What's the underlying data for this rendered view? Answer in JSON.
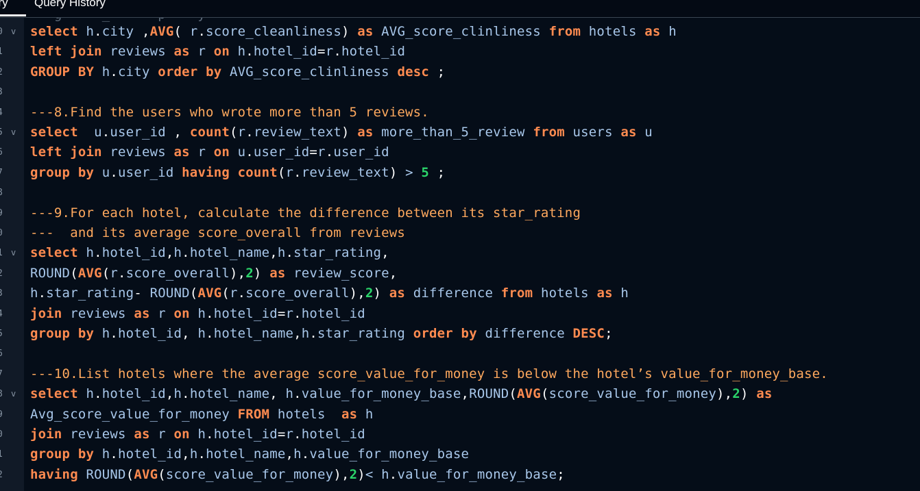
{
  "tabs": [
    {
      "label": "ery"
    },
    {
      "label": "Query History"
    }
  ],
  "partial_top_line": "-- g     _      p    y",
  "line_numbers": [
    "0",
    "1",
    "2",
    "3",
    "4",
    "5",
    "6",
    "7",
    "8",
    "9",
    "0",
    "1",
    "2",
    "3",
    "4",
    "5",
    "6",
    "7",
    "8",
    "9",
    "0",
    "1",
    "2"
  ],
  "fold_rows": [
    0,
    5,
    11,
    18
  ],
  "fold_glyph": "v",
  "code_lines": [
    [
      [
        "kw",
        "select"
      ],
      [
        "id",
        " h"
      ],
      [
        "p",
        "."
      ],
      [
        "id",
        "city "
      ],
      [
        "p",
        ","
      ],
      [
        "kw",
        "AVG"
      ],
      [
        "p",
        "("
      ],
      [
        "id",
        " r"
      ],
      [
        "p",
        "."
      ],
      [
        "id",
        "score_cleanliness"
      ],
      [
        "p",
        ")"
      ],
      [
        "kw",
        " as "
      ],
      [
        "id",
        "AVG_score_clinliness "
      ],
      [
        "kw",
        "from "
      ],
      [
        "id",
        "hotels "
      ],
      [
        "kw",
        "as "
      ],
      [
        "id",
        "h"
      ]
    ],
    [
      [
        "kw",
        "left join "
      ],
      [
        "id",
        "reviews "
      ],
      [
        "kw",
        "as "
      ],
      [
        "id",
        "r "
      ],
      [
        "kw",
        "on "
      ],
      [
        "id",
        "h"
      ],
      [
        "p",
        "."
      ],
      [
        "id",
        "hotel_id"
      ],
      [
        "p",
        "="
      ],
      [
        "id",
        "r"
      ],
      [
        "p",
        "."
      ],
      [
        "id",
        "hotel_id"
      ]
    ],
    [
      [
        "kw",
        "GROUP BY "
      ],
      [
        "id",
        "h"
      ],
      [
        "p",
        "."
      ],
      [
        "id",
        "city "
      ],
      [
        "kw",
        "order by "
      ],
      [
        "id",
        "AVG_score_clinliness "
      ],
      [
        "kw",
        "desc "
      ],
      [
        "p",
        ";"
      ]
    ],
    [],
    [
      [
        "cm",
        "---8.Find the users who wrote more than 5 reviews."
      ]
    ],
    [
      [
        "kw",
        "select  "
      ],
      [
        "id",
        "u"
      ],
      [
        "p",
        "."
      ],
      [
        "id",
        "user_id "
      ],
      [
        "p",
        ", "
      ],
      [
        "kw",
        "count"
      ],
      [
        "p",
        "("
      ],
      [
        "id",
        "r"
      ],
      [
        "p",
        "."
      ],
      [
        "id",
        "review_text"
      ],
      [
        "p",
        ")"
      ],
      [
        "kw",
        " as "
      ],
      [
        "id",
        "more_than_5_review "
      ],
      [
        "kw",
        "from "
      ],
      [
        "id",
        "users "
      ],
      [
        "kw",
        "as "
      ],
      [
        "id",
        "u"
      ]
    ],
    [
      [
        "kw",
        "left join "
      ],
      [
        "id",
        "reviews "
      ],
      [
        "kw",
        "as "
      ],
      [
        "id",
        "r "
      ],
      [
        "kw",
        "on "
      ],
      [
        "id",
        "u"
      ],
      [
        "p",
        "."
      ],
      [
        "id",
        "user_id"
      ],
      [
        "p",
        "="
      ],
      [
        "id",
        "r"
      ],
      [
        "p",
        "."
      ],
      [
        "id",
        "user_id"
      ]
    ],
    [
      [
        "kw",
        "group by "
      ],
      [
        "id",
        "u"
      ],
      [
        "p",
        "."
      ],
      [
        "id",
        "user_id "
      ],
      [
        "kw",
        "having "
      ],
      [
        "kw",
        "count"
      ],
      [
        "p",
        "("
      ],
      [
        "id",
        "r"
      ],
      [
        "p",
        "."
      ],
      [
        "id",
        "review_text"
      ],
      [
        "p",
        ") "
      ],
      [
        "id",
        "> "
      ],
      [
        "nm",
        "5"
      ],
      [
        "p",
        " ;"
      ]
    ],
    [],
    [
      [
        "cm",
        "---9.For each hotel, calculate the difference between its star_rating"
      ]
    ],
    [
      [
        "cm",
        "---  and its average score_overall from reviews"
      ]
    ],
    [
      [
        "kw",
        "select "
      ],
      [
        "id",
        "h"
      ],
      [
        "p",
        "."
      ],
      [
        "id",
        "hotel_id"
      ],
      [
        "p",
        ","
      ],
      [
        "id",
        "h"
      ],
      [
        "p",
        "."
      ],
      [
        "id",
        "hotel_name"
      ],
      [
        "p",
        ","
      ],
      [
        "id",
        "h"
      ],
      [
        "p",
        "."
      ],
      [
        "id",
        "star_rating"
      ],
      [
        "p",
        ","
      ]
    ],
    [
      [
        "fn",
        "ROUND"
      ],
      [
        "p",
        "("
      ],
      [
        "kw",
        "AVG"
      ],
      [
        "p",
        "("
      ],
      [
        "id",
        "r"
      ],
      [
        "p",
        "."
      ],
      [
        "id",
        "score_overall"
      ],
      [
        "p",
        "),"
      ],
      [
        "nm",
        "2"
      ],
      [
        "p",
        ")"
      ],
      [
        "kw",
        " as "
      ],
      [
        "id",
        "review_score"
      ],
      [
        "p",
        ","
      ]
    ],
    [
      [
        "id",
        "h"
      ],
      [
        "p",
        "."
      ],
      [
        "id",
        "star_rating"
      ],
      [
        "p",
        "- "
      ],
      [
        "fn",
        "ROUND"
      ],
      [
        "p",
        "("
      ],
      [
        "kw",
        "AVG"
      ],
      [
        "p",
        "("
      ],
      [
        "id",
        "r"
      ],
      [
        "p",
        "."
      ],
      [
        "id",
        "score_overall"
      ],
      [
        "p",
        "),"
      ],
      [
        "nm",
        "2"
      ],
      [
        "p",
        ")"
      ],
      [
        "kw",
        " as "
      ],
      [
        "id",
        "difference "
      ],
      [
        "kw",
        "from "
      ],
      [
        "id",
        "hotels "
      ],
      [
        "kw",
        "as "
      ],
      [
        "id",
        "h"
      ]
    ],
    [
      [
        "kw",
        "join "
      ],
      [
        "id",
        "reviews "
      ],
      [
        "kw",
        "as "
      ],
      [
        "id",
        "r "
      ],
      [
        "kw",
        "on "
      ],
      [
        "id",
        "h"
      ],
      [
        "p",
        "."
      ],
      [
        "id",
        "hotel_id"
      ],
      [
        "p",
        "="
      ],
      [
        "id",
        "r"
      ],
      [
        "p",
        "."
      ],
      [
        "id",
        "hotel_id"
      ]
    ],
    [
      [
        "kw",
        "group by "
      ],
      [
        "id",
        "h"
      ],
      [
        "p",
        "."
      ],
      [
        "id",
        "hotel_id"
      ],
      [
        "p",
        ", "
      ],
      [
        "id",
        "h"
      ],
      [
        "p",
        "."
      ],
      [
        "id",
        "hotel_name"
      ],
      [
        "p",
        ","
      ],
      [
        "id",
        "h"
      ],
      [
        "p",
        "."
      ],
      [
        "id",
        "star_rating "
      ],
      [
        "kw",
        "order by "
      ],
      [
        "id",
        "difference "
      ],
      [
        "kw",
        "DESC"
      ],
      [
        "p",
        ";"
      ]
    ],
    [],
    [
      [
        "cm",
        "---10.List hotels where the average score_value_for_money is below the hotel’s value_for_money_base."
      ]
    ],
    [
      [
        "kw",
        "select "
      ],
      [
        "id",
        "h"
      ],
      [
        "p",
        "."
      ],
      [
        "id",
        "hotel_id"
      ],
      [
        "p",
        ","
      ],
      [
        "id",
        "h"
      ],
      [
        "p",
        "."
      ],
      [
        "id",
        "hotel_name"
      ],
      [
        "p",
        ", "
      ],
      [
        "id",
        "h"
      ],
      [
        "p",
        "."
      ],
      [
        "id",
        "value_for_money_base"
      ],
      [
        "p",
        ","
      ],
      [
        "fn",
        "ROUND"
      ],
      [
        "p",
        "("
      ],
      [
        "kw",
        "AVG"
      ],
      [
        "p",
        "("
      ],
      [
        "id",
        "score_value_for_money"
      ],
      [
        "p",
        "),"
      ],
      [
        "nm",
        "2"
      ],
      [
        "p",
        ")"
      ],
      [
        "kw",
        " as"
      ]
    ],
    [
      [
        "id",
        "Avg_score_value_for_money "
      ],
      [
        "kw",
        "FROM "
      ],
      [
        "id",
        "hotels  "
      ],
      [
        "kw",
        "as "
      ],
      [
        "id",
        "h"
      ]
    ],
    [
      [
        "kw",
        "join "
      ],
      [
        "id",
        "reviews "
      ],
      [
        "kw",
        "as "
      ],
      [
        "id",
        "r "
      ],
      [
        "kw",
        "on "
      ],
      [
        "id",
        "h"
      ],
      [
        "p",
        "."
      ],
      [
        "id",
        "hotel_id"
      ],
      [
        "p",
        "="
      ],
      [
        "id",
        "r"
      ],
      [
        "p",
        "."
      ],
      [
        "id",
        "hotel_id"
      ]
    ],
    [
      [
        "kw",
        "group by "
      ],
      [
        "id",
        "h"
      ],
      [
        "p",
        "."
      ],
      [
        "id",
        "hotel_id"
      ],
      [
        "p",
        ","
      ],
      [
        "id",
        "h"
      ],
      [
        "p",
        "."
      ],
      [
        "id",
        "hotel_name"
      ],
      [
        "p",
        ","
      ],
      [
        "id",
        "h"
      ],
      [
        "p",
        "."
      ],
      [
        "id",
        "value_for_money_base"
      ]
    ],
    [
      [
        "kw",
        "having "
      ],
      [
        "fn",
        "ROUND"
      ],
      [
        "p",
        "("
      ],
      [
        "kw",
        "AVG"
      ],
      [
        "p",
        "("
      ],
      [
        "id",
        "score_value_for_money"
      ],
      [
        "p",
        "),"
      ],
      [
        "nm",
        "2"
      ],
      [
        "p",
        ")"
      ],
      [
        "id",
        "< "
      ],
      [
        "id",
        "h"
      ],
      [
        "p",
        "."
      ],
      [
        "id",
        "value_for_money_base"
      ],
      [
        "p",
        ";"
      ]
    ]
  ]
}
